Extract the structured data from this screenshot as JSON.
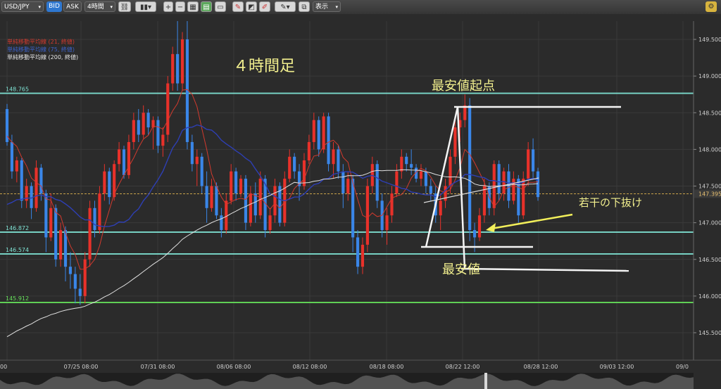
{
  "toolbar": {
    "symbol": "USD/JPY",
    "bid_label": "BID",
    "ask_label": "ASK",
    "timeframe": "4時間",
    "display_label": "表示"
  },
  "legend": {
    "sma21": "単純移動平均線 (21, 終値)",
    "sma_blue": "単純移動平均線 (75, 終値)",
    "sma200": "単純移動平均線 (200, 終値)"
  },
  "annotations": {
    "timeframe": "４時間足",
    "start_low": "最安値起点",
    "slight_break": "若干の下抜け",
    "lowest": "最安値"
  },
  "chart_data": {
    "type": "candlestick",
    "y_axis": {
      "range": [
        145.3,
        149.75
      ],
      "ticks": [
        "149.500",
        "149.000",
        "148.500",
        "148.000",
        "147.500",
        "147.000",
        "146.500",
        "146.000",
        "145.500"
      ]
    },
    "x_axis": {
      "labels": [
        "00",
        "07/25 08:00",
        "07/31 08:00",
        "08/06 08:00",
        "08/12 08:00",
        "08/18 08:00",
        "08/22 12:00",
        "08/28 12:00",
        "09/03 12:00",
        "09/0"
      ]
    },
    "current_price": "147.395",
    "horizontal_levels": [
      {
        "label": "148.765",
        "value": 148.765,
        "color": "#7fe3d4"
      },
      {
        "label": "146.872",
        "value": 146.872,
        "color": "#7fe3d4"
      },
      {
        "label": "146.574",
        "value": 146.574,
        "color": "#7fe3d4"
      },
      {
        "label": "145.912",
        "value": 145.912,
        "color": "#66e15a"
      }
    ],
    "candles_ohlc": [
      [
        148.55,
        148.62,
        148.05,
        148.1
      ],
      [
        148.1,
        148.2,
        147.6,
        147.7
      ],
      [
        147.7,
        147.9,
        147.55,
        147.85
      ],
      [
        147.85,
        147.88,
        147.2,
        147.3
      ],
      [
        147.3,
        147.6,
        147.2,
        147.5
      ],
      [
        147.5,
        147.55,
        147.05,
        147.2
      ],
      [
        147.2,
        147.85,
        147.15,
        147.75
      ],
      [
        147.75,
        147.8,
        147.3,
        147.4
      ],
      [
        147.4,
        147.45,
        146.6,
        146.8
      ],
      [
        146.8,
        147.4,
        146.75,
        147.2
      ],
      [
        147.2,
        147.25,
        146.4,
        146.5
      ],
      [
        146.5,
        147.0,
        146.4,
        146.9
      ],
      [
        146.9,
        146.95,
        146.2,
        146.4
      ],
      [
        146.4,
        146.6,
        146.1,
        146.3
      ],
      [
        146.3,
        146.4,
        145.9,
        146.1
      ],
      [
        146.1,
        146.3,
        145.88,
        146.0
      ],
      [
        146.0,
        146.6,
        145.9,
        146.5
      ],
      [
        146.5,
        147.3,
        146.4,
        147.2
      ],
      [
        147.2,
        147.3,
        146.8,
        146.9
      ],
      [
        146.9,
        147.5,
        146.85,
        147.4
      ],
      [
        147.4,
        147.8,
        147.3,
        147.7
      ],
      [
        147.7,
        147.75,
        147.25,
        147.35
      ],
      [
        147.35,
        147.85,
        147.3,
        147.8
      ],
      [
        147.8,
        148.1,
        147.7,
        148.0
      ],
      [
        148.0,
        148.05,
        147.6,
        147.65
      ],
      [
        147.65,
        148.2,
        147.6,
        148.1
      ],
      [
        148.1,
        148.5,
        148.0,
        148.4
      ],
      [
        148.4,
        148.55,
        148.1,
        148.2
      ],
      [
        148.2,
        148.6,
        148.15,
        148.5
      ],
      [
        148.5,
        148.55,
        148.2,
        148.3
      ],
      [
        148.3,
        148.45,
        148.0,
        148.4
      ],
      [
        148.4,
        148.45,
        147.95,
        148.05
      ],
      [
        148.05,
        148.3,
        147.9,
        148.2
      ],
      [
        148.2,
        149.0,
        148.1,
        148.9
      ],
      [
        148.9,
        149.4,
        148.8,
        149.3
      ],
      [
        149.3,
        149.75,
        148.8,
        148.9
      ],
      [
        148.9,
        149.6,
        148.8,
        149.5
      ],
      [
        149.5,
        149.75,
        148.0,
        148.1
      ],
      [
        148.1,
        148.2,
        147.7,
        147.8
      ],
      [
        147.8,
        148.0,
        147.5,
        147.9
      ],
      [
        147.9,
        147.95,
        147.4,
        147.5
      ],
      [
        147.5,
        147.7,
        147.0,
        147.2
      ],
      [
        147.2,
        147.6,
        147.15,
        147.5
      ],
      [
        147.5,
        147.55,
        147.05,
        147.1
      ],
      [
        147.1,
        147.2,
        146.8,
        146.9
      ],
      [
        146.9,
        147.4,
        146.85,
        147.3
      ],
      [
        147.3,
        147.8,
        147.25,
        147.7
      ],
      [
        147.7,
        147.75,
        147.3,
        147.4
      ],
      [
        147.4,
        147.65,
        147.35,
        147.6
      ],
      [
        147.6,
        147.65,
        146.9,
        147.0
      ],
      [
        147.0,
        147.5,
        146.95,
        147.4
      ],
      [
        147.4,
        147.55,
        147.0,
        147.1
      ],
      [
        147.1,
        147.7,
        147.05,
        147.6
      ],
      [
        147.6,
        147.65,
        146.8,
        146.9
      ],
      [
        146.9,
        147.2,
        146.85,
        147.1
      ],
      [
        147.1,
        147.6,
        147.0,
        147.5
      ],
      [
        147.5,
        147.55,
        146.95,
        147.0
      ],
      [
        147.0,
        147.7,
        146.95,
        147.6
      ],
      [
        147.6,
        148.0,
        147.55,
        147.9
      ],
      [
        147.9,
        147.95,
        147.6,
        147.7
      ],
      [
        147.7,
        147.8,
        147.3,
        147.5
      ],
      [
        147.5,
        147.95,
        147.45,
        147.85
      ],
      [
        147.85,
        148.2,
        147.8,
        148.1
      ],
      [
        148.1,
        148.5,
        148.0,
        148.4
      ],
      [
        148.4,
        148.45,
        147.9,
        148.0
      ],
      [
        148.0,
        148.5,
        147.95,
        148.45
      ],
      [
        148.45,
        148.5,
        147.7,
        147.8
      ],
      [
        147.8,
        148.1,
        147.6,
        148.0
      ],
      [
        148.0,
        148.05,
        147.6,
        147.7
      ],
      [
        147.7,
        147.8,
        147.2,
        147.4
      ],
      [
        147.4,
        147.7,
        147.3,
        147.6
      ],
      [
        147.6,
        147.65,
        146.6,
        146.8
      ],
      [
        146.8,
        146.9,
        146.3,
        146.4
      ],
      [
        146.4,
        146.8,
        146.3,
        146.7
      ],
      [
        146.7,
        147.6,
        146.6,
        147.5
      ],
      [
        147.5,
        147.9,
        147.4,
        147.8
      ],
      [
        147.8,
        147.85,
        147.2,
        147.3
      ],
      [
        147.3,
        147.4,
        146.8,
        146.9
      ],
      [
        146.9,
        147.2,
        146.7,
        147.1
      ],
      [
        147.1,
        147.5,
        147.0,
        147.4
      ],
      [
        147.4,
        147.8,
        147.35,
        147.7
      ],
      [
        147.7,
        148.0,
        147.6,
        147.9
      ],
      [
        147.9,
        147.95,
        147.7,
        147.8
      ],
      [
        147.8,
        148.0,
        147.65,
        147.75
      ],
      [
        147.75,
        147.8,
        147.55,
        147.6
      ],
      [
        147.6,
        147.8,
        147.5,
        147.7
      ],
      [
        147.7,
        147.75,
        147.4,
        147.5
      ],
      [
        147.5,
        147.6,
        147.3,
        147.4
      ],
      [
        147.4,
        147.5,
        147.0,
        147.1
      ],
      [
        147.1,
        147.4,
        146.9,
        147.3
      ],
      [
        147.3,
        147.6,
        147.2,
        147.5
      ],
      [
        147.5,
        148.0,
        147.4,
        147.9
      ],
      [
        147.9,
        148.4,
        147.8,
        148.3
      ],
      [
        148.3,
        148.5,
        148.1,
        148.4
      ],
      [
        148.4,
        148.75,
        148.3,
        148.6
      ],
      [
        148.6,
        148.7,
        146.75,
        146.9
      ],
      [
        146.9,
        147.0,
        146.6,
        146.8
      ],
      [
        146.8,
        147.2,
        146.75,
        147.1
      ],
      [
        147.1,
        147.6,
        147.0,
        147.5
      ],
      [
        147.5,
        147.55,
        147.1,
        147.2
      ],
      [
        147.2,
        147.85,
        147.1,
        147.8
      ],
      [
        147.8,
        147.85,
        147.3,
        147.4
      ],
      [
        147.4,
        147.75,
        147.3,
        147.7
      ],
      [
        147.7,
        147.8,
        147.2,
        147.3
      ],
      [
        147.3,
        147.7,
        147.25,
        147.6
      ],
      [
        147.6,
        147.65,
        147.0,
        147.1
      ],
      [
        147.1,
        147.7,
        147.05,
        147.6
      ],
      [
        147.6,
        148.1,
        147.5,
        148.0
      ],
      [
        148.0,
        148.15,
        147.6,
        147.7
      ],
      [
        147.7,
        147.75,
        147.3,
        147.35
      ]
    ]
  }
}
